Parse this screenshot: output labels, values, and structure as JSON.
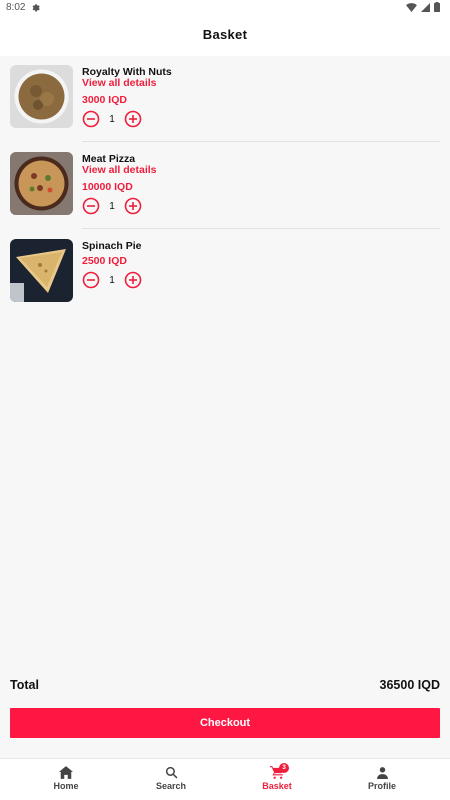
{
  "status_bar": {
    "time": "8:02"
  },
  "header": {
    "title": "Basket"
  },
  "items": [
    {
      "name": "Royalty With Nuts",
      "details_label": "View all details",
      "price": "3000 IQD",
      "quantity": "1"
    },
    {
      "name": "Meat Pizza",
      "details_label": "View all details",
      "price": "10000 IQD",
      "quantity": "1"
    },
    {
      "name": "Spinach Pie",
      "price": "2500 IQD",
      "quantity": "1"
    }
  ],
  "summary": {
    "total_label": "Total",
    "total_value": "36500 IQD"
  },
  "checkout": {
    "label": "Checkout"
  },
  "nav": {
    "items": [
      {
        "label": "Home",
        "icon": "home-icon"
      },
      {
        "label": "Search",
        "icon": "search-icon"
      },
      {
        "label": "Basket",
        "icon": "cart-icon",
        "badge": "3"
      },
      {
        "label": "Profile",
        "icon": "person-icon"
      }
    ]
  },
  "colors": {
    "accent": "#ee1f3d",
    "button": "#ff1744",
    "background": "#f7f7f7"
  }
}
